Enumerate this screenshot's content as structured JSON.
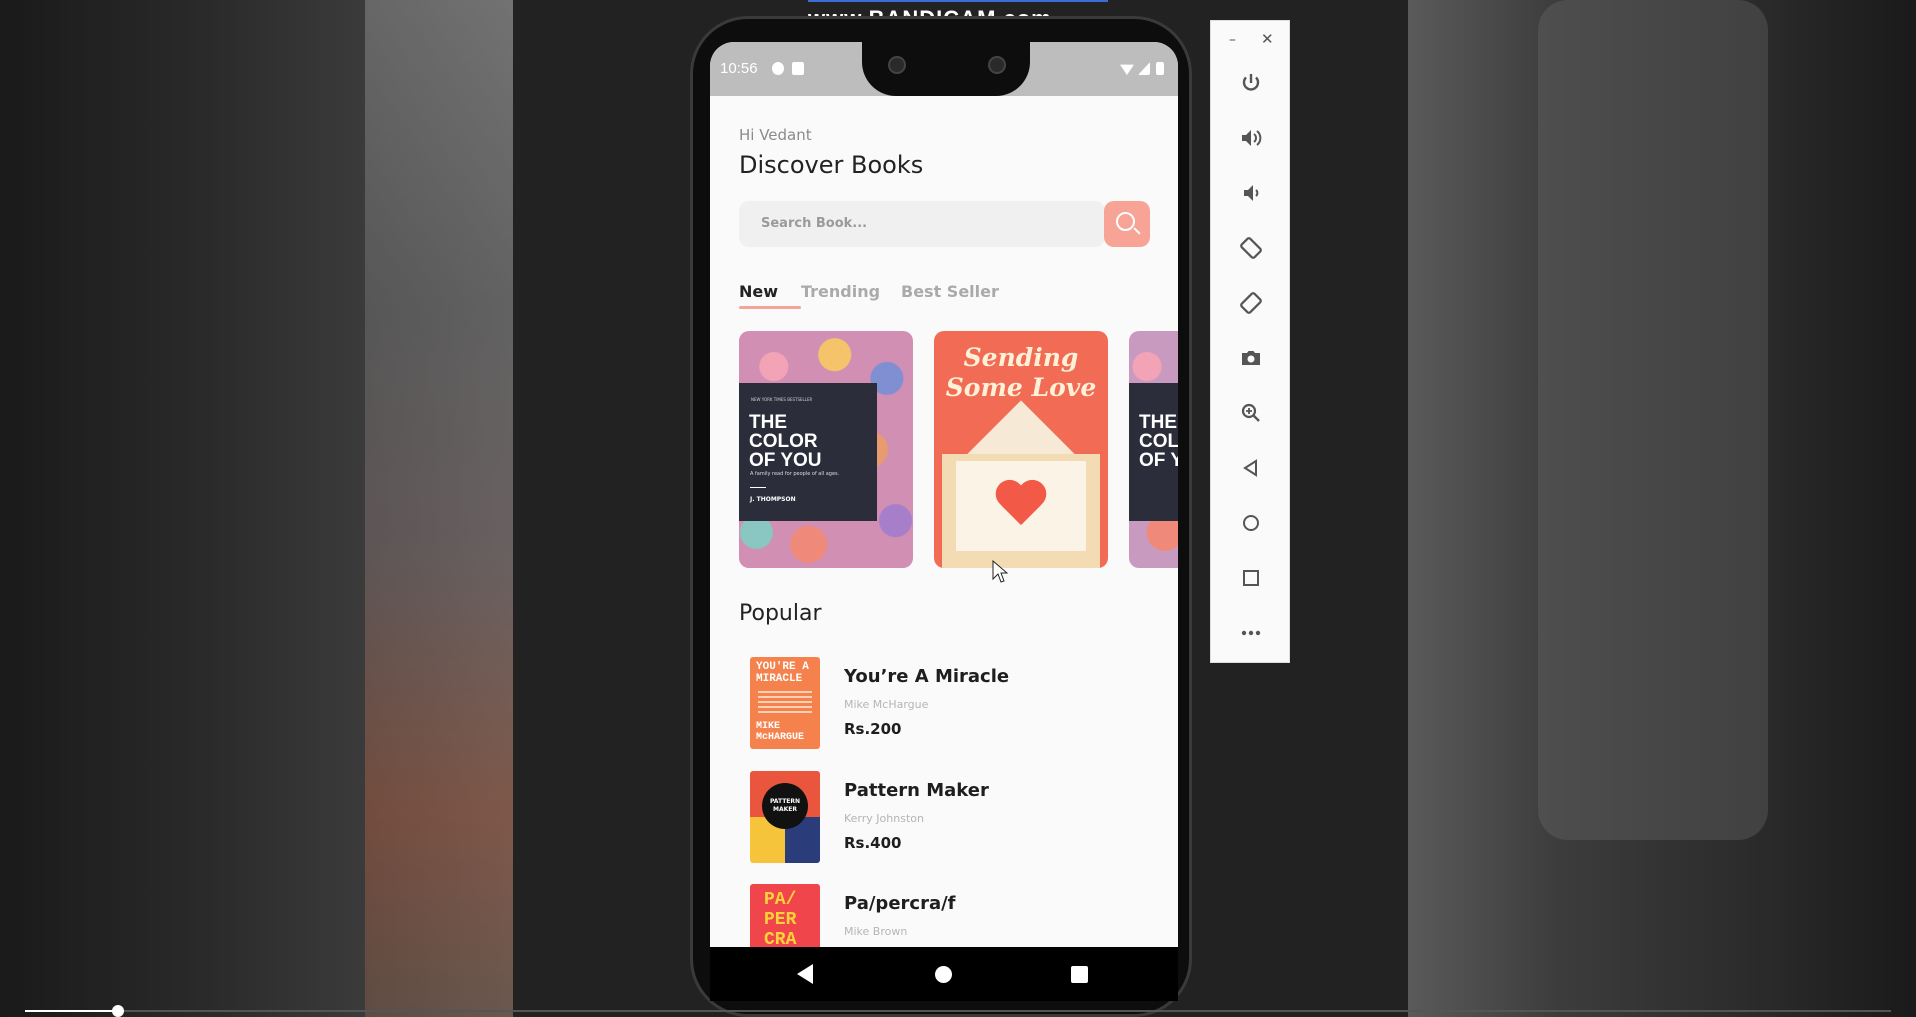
{
  "watermark": "www.BANDICAM.com",
  "status_bar": {
    "time": "10:56"
  },
  "app": {
    "greeting": "Hi Vedant",
    "title": "Discover Books",
    "search": {
      "placeholder": "Search Book..."
    },
    "tabs": [
      {
        "label": "New",
        "active": true
      },
      {
        "label": "Trending",
        "active": false
      },
      {
        "label": "Best Seller",
        "active": false
      }
    ],
    "covers": [
      {
        "small": "NEW YORK TIMES BESTSELLER",
        "title": "THE\nCOLOR\nOF YOU",
        "subtitle": "A family read for people of all ages.",
        "author": "J. THOMPSON"
      },
      {
        "title": "Sending\nSome Love"
      },
      {
        "title": "THE\nCOL\nOF Y"
      }
    ],
    "section_title": "Popular",
    "popular": [
      {
        "cover_title": "YOU'RE A\nMIRACLE",
        "cover_author": "MIKE\nMcHARGUE",
        "title": "You’re A Miracle",
        "author": "Mike McHargue",
        "price": "Rs.200"
      },
      {
        "cover_title": "PATTERN\nMAKER",
        "title": "Pattern Maker",
        "author": "Kerry Johnston",
        "price": "Rs.400"
      },
      {
        "cover_title": "PA/\nPER\nCRA",
        "title": "Pa/percra/f",
        "author": "Mike Brown",
        "price": ""
      }
    ],
    "accent_color": "#f7a497"
  },
  "emulator": {
    "window_min": "–",
    "window_close": "✕",
    "buttons": [
      "power-icon",
      "volume-up-icon",
      "volume-down-icon",
      "rotate-left-icon",
      "rotate-right-icon",
      "camera-icon",
      "zoom-icon",
      "back-icon",
      "home-icon",
      "overview-icon",
      "more-icon"
    ]
  },
  "video": {
    "progress": 0.05
  }
}
